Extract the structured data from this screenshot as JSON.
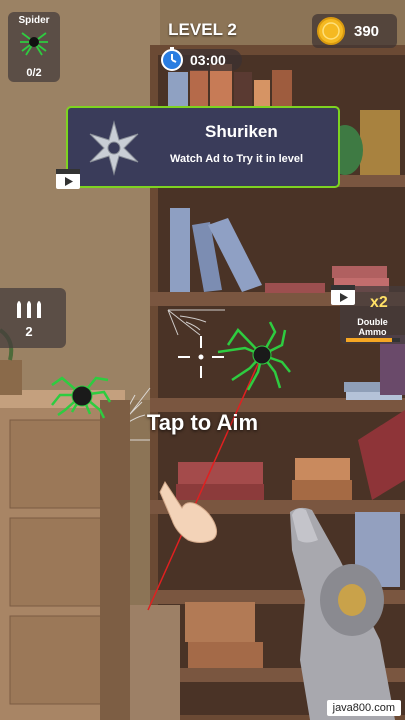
{
  "target": {
    "label": "Spider",
    "count": "0/2",
    "icon": "spider-icon"
  },
  "level": {
    "label": "LEVEL 2"
  },
  "timer": {
    "time": "03:00",
    "icon": "stopwatch-icon"
  },
  "coins": {
    "amount": "390",
    "icon": "coin-icon"
  },
  "ad_offer": {
    "title": "Shuriken",
    "subtitle": "Watch Ad to Try it in level",
    "icon": "shuriken-icon",
    "badge": "video-ad-icon",
    "accent": "#7ed321"
  },
  "ammo": {
    "count": "2",
    "icon": "bullets-icon"
  },
  "double_ammo": {
    "multiplier": "x2",
    "label_line1": "Double",
    "label_line2": "Ammo",
    "progress": 0.85,
    "badge": "video-ad-icon"
  },
  "hint": {
    "text": "Tap to Aim"
  },
  "watermark": {
    "text": "java800.com"
  }
}
